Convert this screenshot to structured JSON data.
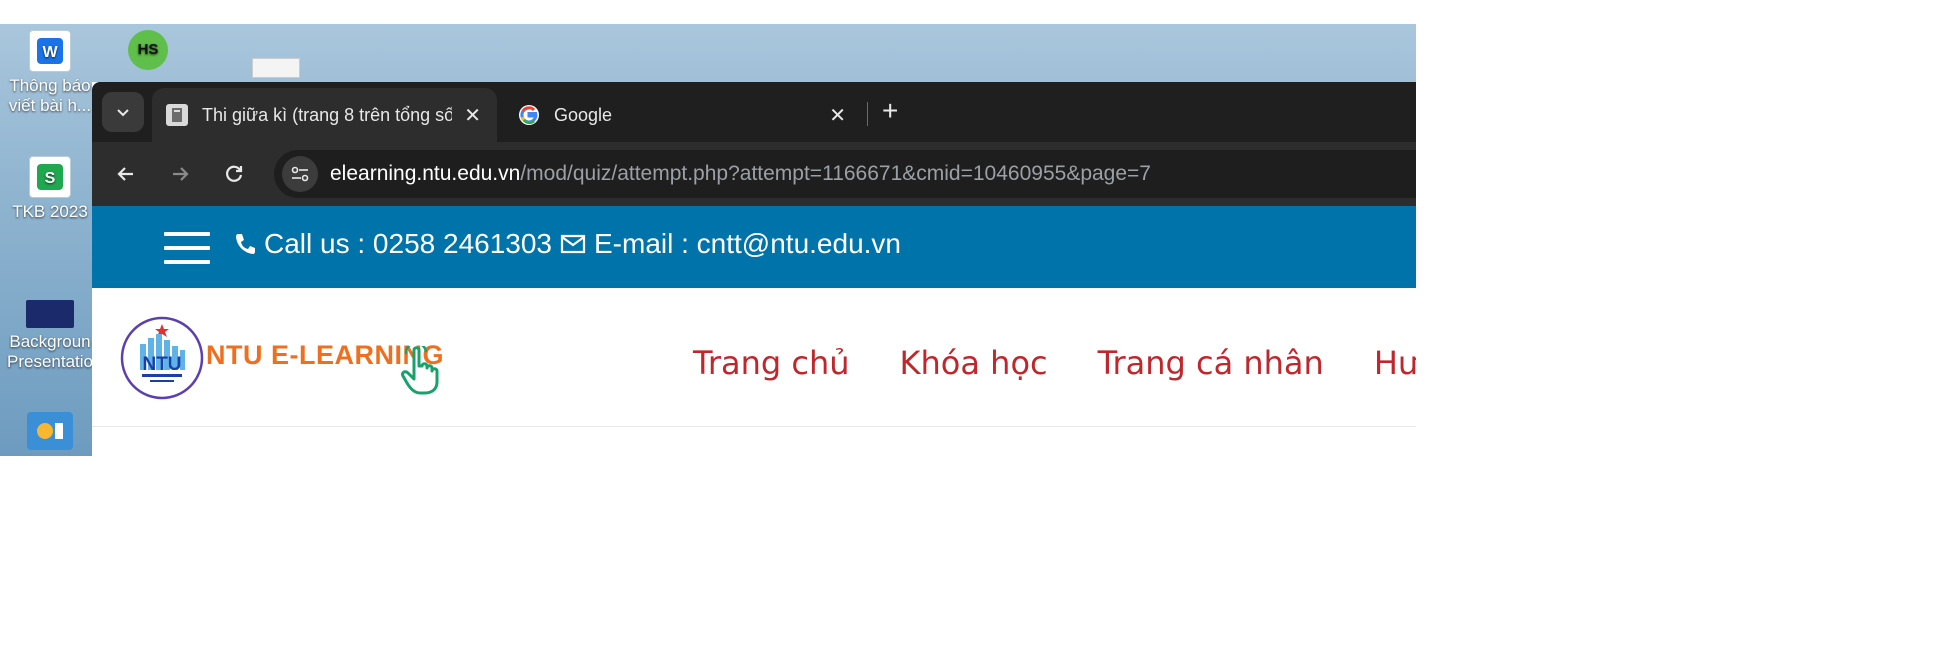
{
  "desktop": {
    "icons": [
      {
        "label": "Thông báo\nviết bài h...",
        "type": "word"
      },
      {
        "label": "",
        "type": "hs-shortcut",
        "glyph": "HS"
      },
      {
        "label": "",
        "type": "file"
      },
      {
        "label": "TKB 2023",
        "type": "sheet"
      },
      {
        "label": "Backgroun\nPresentatio",
        "type": "image"
      },
      {
        "label": "",
        "type": "app"
      }
    ]
  },
  "browser": {
    "tabs": [
      {
        "title": "Thi giữa kì (trang 8 trên tổng số",
        "active": true,
        "favicon": "moodle-icon"
      },
      {
        "title": "Google",
        "active": false,
        "favicon": "google-icon"
      }
    ],
    "new_tab_label": "+",
    "address": {
      "host": "elearning.ntu.edu.vn",
      "path": "/mod/quiz/attempt.php?attempt=1166671&cmid=10460955&page=7"
    }
  },
  "site": {
    "topbar": {
      "phone_text": "Call us : 0258 2461303",
      "email_text": "E-mail : cntt@ntu.edu.vn"
    },
    "logo_text": "NTU",
    "brand": "NTU E-LEARNING",
    "nav": [
      "Trang chủ",
      "Khóa học",
      "Trang cá nhân",
      "Hướng"
    ]
  },
  "colors": {
    "topbar": "#0073aa",
    "nav_text": "#c0272d",
    "brand": "#ef6f1f",
    "chrome_dark": "#1f1f1f"
  }
}
